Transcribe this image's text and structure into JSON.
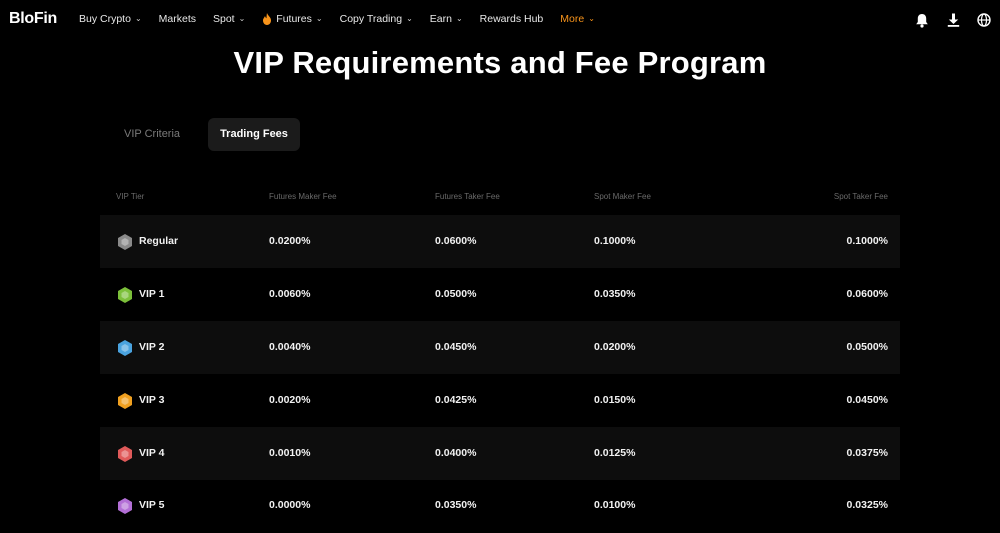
{
  "nav": {
    "logo": "BloFin",
    "items": [
      {
        "label": "Buy Crypto",
        "chevron": true
      },
      {
        "label": "Markets",
        "chevron": false
      },
      {
        "label": "Spot",
        "chevron": true
      },
      {
        "label": "Futures",
        "chevron": true,
        "icon": "fire-icon"
      },
      {
        "label": "Copy Trading",
        "chevron": true
      },
      {
        "label": "Earn",
        "chevron": true
      },
      {
        "label": "Rewards Hub",
        "chevron": false
      },
      {
        "label": "More",
        "chevron": true,
        "highlight": "#f7931a"
      }
    ],
    "right_icons": [
      "bell-icon",
      "download-icon",
      "globe-icon"
    ]
  },
  "page": {
    "title": "VIP Requirements and Fee Program"
  },
  "tabs": [
    {
      "label": "VIP Criteria",
      "active": false
    },
    {
      "label": "Trading Fees",
      "active": true
    }
  ],
  "table": {
    "headers": [
      "VIP Tier",
      "Futures Maker Fee",
      "Futures Taker Fee",
      "Spot Maker Fee",
      "Spot Taker Fee"
    ],
    "rows": [
      {
        "tier": "Regular",
        "badge_color": "#8a8a8a",
        "futures_maker": "0.0200%",
        "futures_taker": "0.0600%",
        "spot_maker": "0.1000%",
        "spot_taker": "0.1000%"
      },
      {
        "tier": "VIP 1",
        "badge_color": "#7cc03a",
        "futures_maker": "0.0060%",
        "futures_taker": "0.0500%",
        "spot_maker": "0.0350%",
        "spot_taker": "0.0600%"
      },
      {
        "tier": "VIP 2",
        "badge_color": "#4aa3df",
        "futures_maker": "0.0040%",
        "futures_taker": "0.0450%",
        "spot_maker": "0.0200%",
        "spot_taker": "0.0500%"
      },
      {
        "tier": "VIP 3",
        "badge_color": "#f0a020",
        "futures_maker": "0.0020%",
        "futures_taker": "0.0425%",
        "spot_maker": "0.0150%",
        "spot_taker": "0.0450%"
      },
      {
        "tier": "VIP 4",
        "badge_color": "#e05a5a",
        "futures_maker": "0.0010%",
        "futures_taker": "0.0400%",
        "spot_maker": "0.0125%",
        "spot_taker": "0.0375%"
      },
      {
        "tier": "VIP 5",
        "badge_color": "#b36fd6",
        "futures_maker": "0.0000%",
        "futures_taker": "0.0350%",
        "spot_maker": "0.0100%",
        "spot_taker": "0.0325%"
      }
    ]
  }
}
